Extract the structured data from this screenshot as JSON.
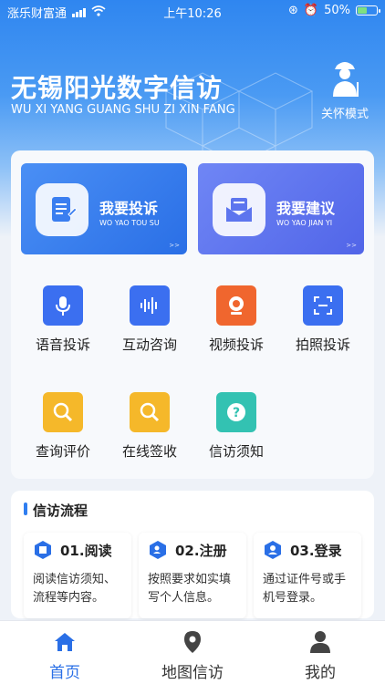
{
  "status": {
    "carrier": "涨乐财富通",
    "time": "上午10:26",
    "battery": "50%",
    "battery_level": 0.5
  },
  "header": {
    "title": "无锡阳光数字信访",
    "subtitle": "WU XI YANG GUANG SHU ZI XIN FANG",
    "care_mode": "关怀模式"
  },
  "primary": [
    {
      "label": "我要投诉",
      "sub": "WO YAO TOU SU",
      "arrow": ">>",
      "icon": "document-edit-icon"
    },
    {
      "label": "我要建议",
      "sub": "WO YAO JIAN YI",
      "arrow": ">>",
      "icon": "mail-open-icon"
    }
  ],
  "grid": [
    {
      "label": "语音投诉",
      "icon": "microphone-icon",
      "color": "#3b6ff0"
    },
    {
      "label": "互动咨询",
      "icon": "soundwave-icon",
      "color": "#3b6ff0"
    },
    {
      "label": "视频投诉",
      "icon": "webcam-icon",
      "color": "#f0662e"
    },
    {
      "label": "拍照投诉",
      "icon": "scan-icon",
      "color": "#3b6ff0"
    },
    {
      "label": "查询评价",
      "icon": "magnifier-icon",
      "color": "#f5b82a"
    },
    {
      "label": "在线签收",
      "icon": "magnifier-icon",
      "color": "#f5b82a"
    },
    {
      "label": "信访须知",
      "icon": "question-icon",
      "color": "#33c2b2"
    }
  ],
  "flow": {
    "title": "信访流程",
    "steps": [
      {
        "title": "01.阅读",
        "text": "阅读信访须知、流程等内容。",
        "icon": "book-icon"
      },
      {
        "title": "02.注册",
        "text": "按照要求如实填写个人信息。",
        "icon": "user-add-icon"
      },
      {
        "title": "03.登录",
        "text": "通过证件号或手机号登录。",
        "icon": "user-icon"
      }
    ]
  },
  "tabs": [
    {
      "label": "首页",
      "icon": "home-icon"
    },
    {
      "label": "地图信访",
      "icon": "map-pin-icon"
    },
    {
      "label": "我的",
      "icon": "person-icon"
    }
  ],
  "colors": {
    "accent": "#2a6fe6",
    "hero": "#2f86f0"
  }
}
